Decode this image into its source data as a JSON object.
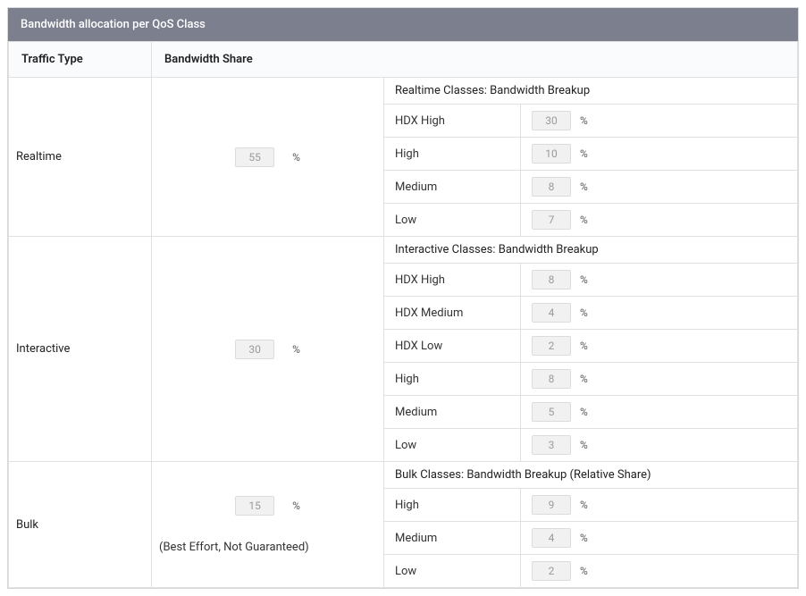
{
  "header": {
    "title": "Bandwidth allocation per QoS Class"
  },
  "columns": {
    "traffic_type": "Traffic Type",
    "bandwidth_share": "Bandwidth Share"
  },
  "percent_symbol": "%",
  "rows": [
    {
      "type": "Realtime",
      "share": "55",
      "note": "",
      "breakup_title": "Realtime Classes: Bandwidth Breakup",
      "classes": [
        {
          "label": "HDX High",
          "value": "30"
        },
        {
          "label": "High",
          "value": "10"
        },
        {
          "label": "Medium",
          "value": "8"
        },
        {
          "label": "Low",
          "value": "7"
        }
      ]
    },
    {
      "type": "Interactive",
      "share": "30",
      "note": "",
      "breakup_title": "Interactive Classes: Bandwidth Breakup",
      "classes": [
        {
          "label": "HDX High",
          "value": "8"
        },
        {
          "label": "HDX Medium",
          "value": "4"
        },
        {
          "label": "HDX Low",
          "value": "2"
        },
        {
          "label": "High",
          "value": "8"
        },
        {
          "label": "Medium",
          "value": "5"
        },
        {
          "label": "Low",
          "value": "3"
        }
      ]
    },
    {
      "type": "Bulk",
      "share": "15",
      "note": "(Best Effort, Not Guaranteed)",
      "breakup_title": "Bulk Classes: Bandwidth Breakup (Relative Share)",
      "classes": [
        {
          "label": "High",
          "value": "9"
        },
        {
          "label": "Medium",
          "value": "4"
        },
        {
          "label": "Low",
          "value": "2"
        }
      ]
    }
  ]
}
